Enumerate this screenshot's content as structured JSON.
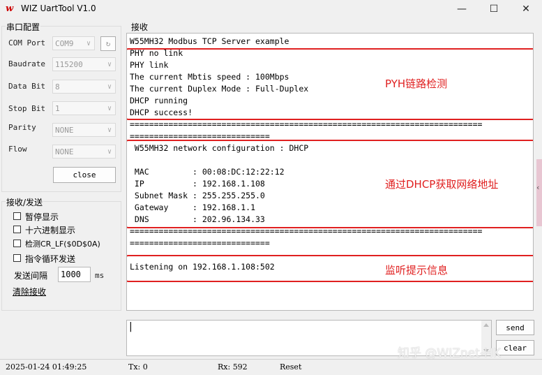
{
  "window": {
    "title": "WIZ UartTool V1.0",
    "min": "—",
    "max": "☐",
    "close": "✕"
  },
  "serial": {
    "group": "串口配置",
    "com_port": {
      "label": "COM Port",
      "value": "COM9"
    },
    "baudrate": {
      "label": "Baudrate",
      "value": "115200"
    },
    "data_bit": {
      "label": "Data Bit",
      "value": "8"
    },
    "stop_bit": {
      "label": "Stop Bit",
      "value": "1"
    },
    "parity": {
      "label": "Parity",
      "value": "NONE"
    },
    "flow": {
      "label": "Flow",
      "value": "NONE"
    },
    "close_button": "close"
  },
  "rxtx": {
    "group": "接收/发送",
    "pause": "暂停显示",
    "hex": "十六进制显示",
    "crlf": "检测CR_LF($0D$0A)",
    "loop": "指令循环发送",
    "interval_label": "发送间隔",
    "interval_value": "1000",
    "interval_unit": "ms",
    "clear_receive": "清除接收"
  },
  "receive": {
    "group": "接收",
    "lines": [
      "W55MH32 Modbus TCP Server example",
      "PHY no link",
      "PHY link",
      "The current Mbtis speed : 100Mbps",
      "The current Duplex Mode : Full-Duplex",
      "DHCP running",
      "DHCP success!",
      "=========================================================================",
      "=============================",
      " W55MH32 network configuration : DHCP",
      "",
      " MAC         : 00:08:DC:12:22:12",
      " IP          : 192.168.1.108",
      " Subnet Mask : 255.255.255.0",
      " Gateway     : 192.168.1.1",
      " DNS         : 202.96.134.33",
      "=========================================================================",
      "=============================",
      "",
      "Listening on 192.168.1.108:502"
    ],
    "annotations": [
      "PYH链路检测",
      "通过DHCP获取网络地址",
      "监听提示信息"
    ]
  },
  "send": {
    "send_button": "send",
    "clear_button": "clear",
    "cursor": "|"
  },
  "watermark": "知乎 @WIZnet-HK",
  "status": {
    "time": "2025-01-24 01:49:25",
    "tx": "Tx: 0",
    "rx": "Rx: 592",
    "reset": "Reset"
  },
  "colors": {
    "accent_red": "#e02020"
  }
}
